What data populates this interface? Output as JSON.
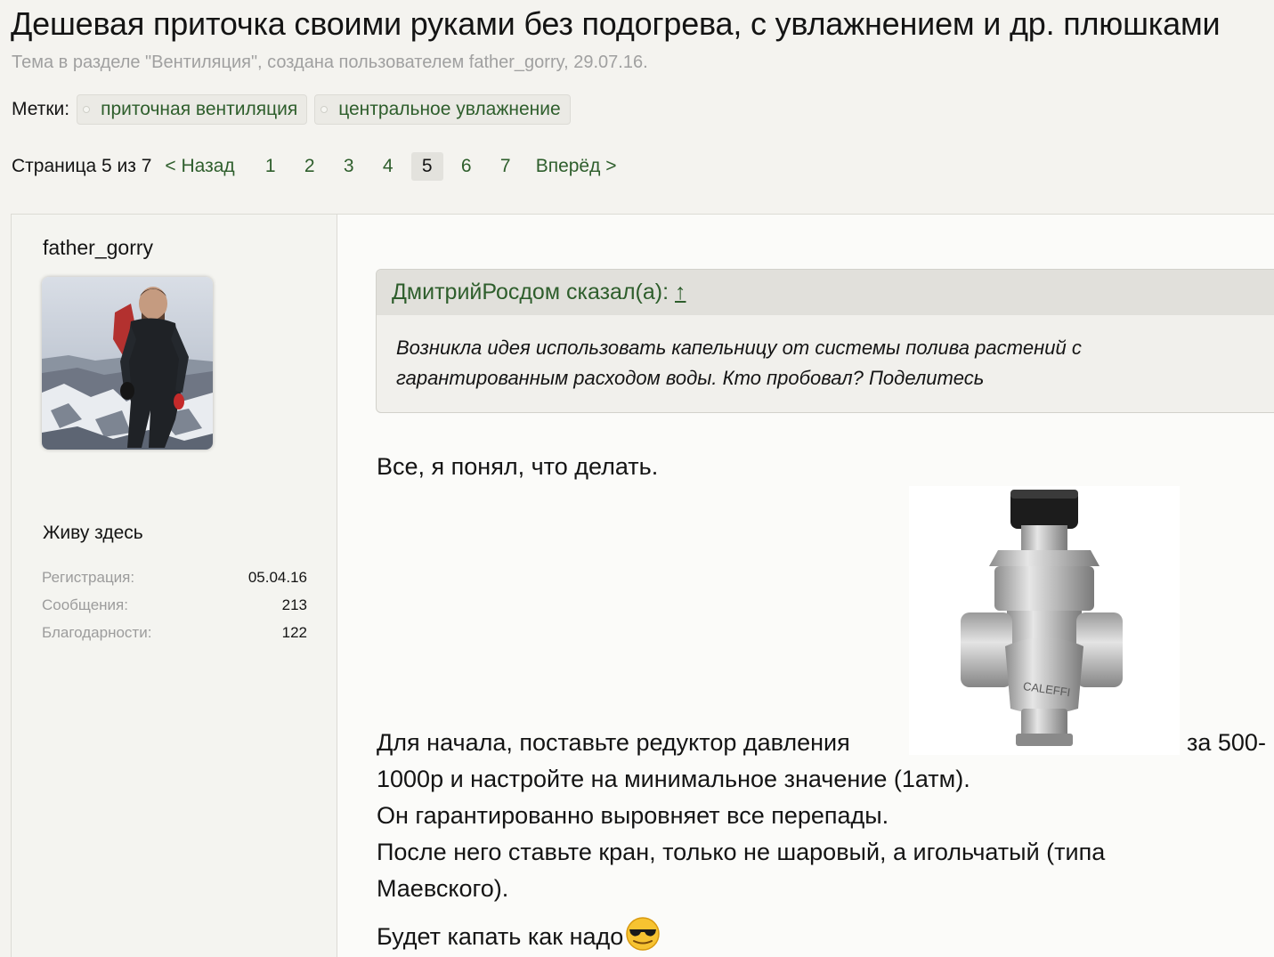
{
  "header": {
    "title": "Дешевая приточка своими руками без подогрева, с увлажнением и др. плюшками",
    "subtitle": "Тема в разделе \"Вентиляция\", создана пользователем father_gorry, 29.07.16."
  },
  "tags": {
    "label": "Метки:",
    "items": [
      "приточная вентиляция",
      "центральное увлажнение"
    ]
  },
  "pagination": {
    "info": "Страница 5 из 7",
    "prev": "< Назад",
    "pages": [
      "1",
      "2",
      "3",
      "4",
      "5",
      "6",
      "7"
    ],
    "current": "5",
    "next": "Вперёд >"
  },
  "post": {
    "username": "father_gorry",
    "user_title": "Живу здесь",
    "stats": [
      {
        "label": "Регистрация:",
        "value": "05.04.16"
      },
      {
        "label": "Сообщения:",
        "value": "213"
      },
      {
        "label": "Благодарности:",
        "value": "122"
      }
    ],
    "quote": {
      "author": "ДмитрийРосдом сказал(а):",
      "arrow": "↑",
      "lines": [
        "Возникла идея использовать капельницу от системы полива растений с",
        "гарантированным расходом воды. Кто пробовал? Поделитесь"
      ]
    },
    "message": {
      "intro": "Все, я понял, что делать.",
      "line1_start": "Для начала, поставьте редуктор давления",
      "line1_end": "за 500-",
      "line2": "1000р и настройте на минимальное значение (1атм).",
      "line3": "Он гарантированно выровняет все перепады.",
      "line4": "После него ставьте кран, только не шаровый, а игольчатый (типа",
      "line5": "Маевского).",
      "line6": "Будет капать как надо"
    }
  },
  "colors": {
    "link": "#2e5e2c",
    "background": "#f4f3ef",
    "muted": "#a0a0a0"
  }
}
